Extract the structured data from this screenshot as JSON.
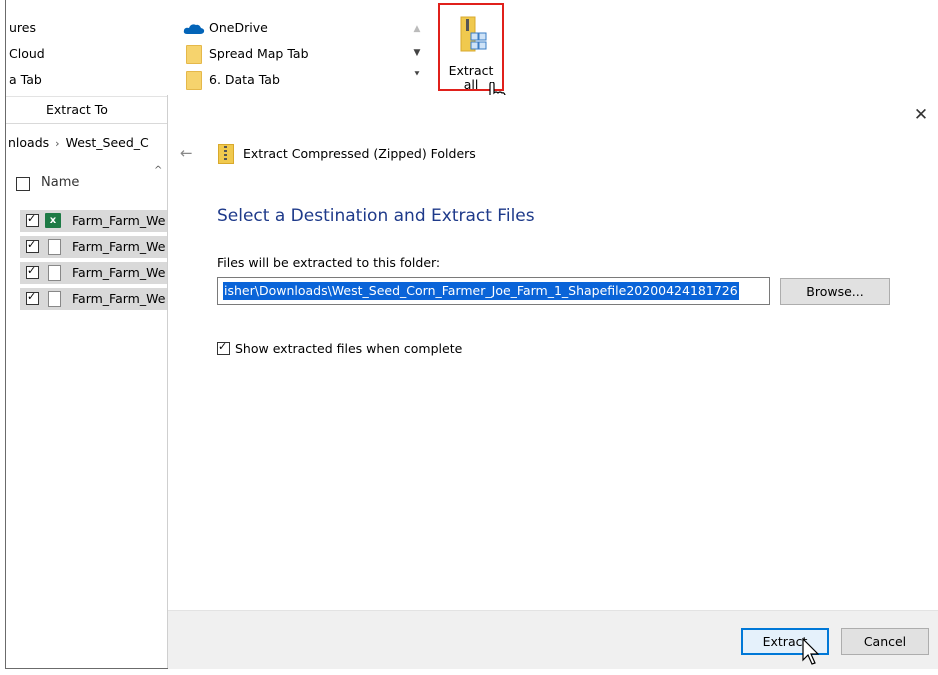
{
  "ribbon": {
    "quick_access_left": [
      "ures",
      "Cloud",
      "a Tab"
    ],
    "quick_access_mid": [
      {
        "label": "OneDrive",
        "icon": "onedrive-cloud-icon"
      },
      {
        "label": "Spread Map Tab",
        "icon": "folder-icon"
      },
      {
        "label": "6.  Data Tab",
        "icon": "folder-icon"
      }
    ],
    "extract_all_label": "Extract all",
    "extract_all_highlight_color": "#e0201b",
    "group_label": "Extract To"
  },
  "explorer": {
    "breadcrumb": [
      "nloads",
      "West_Seed_C"
    ],
    "column_header": "Name",
    "files": [
      {
        "name": "Farm_Farm_We",
        "icon": "excel-icon",
        "checked": true
      },
      {
        "name": "Farm_Farm_We",
        "icon": "document-icon",
        "checked": true
      },
      {
        "name": "Farm_Farm_We",
        "icon": "document-icon",
        "checked": true
      },
      {
        "name": "Farm_Farm_We",
        "icon": "document-icon",
        "checked": true
      }
    ]
  },
  "dialog": {
    "window_title": "Extract Compressed (Zipped) Folders",
    "heading": "Select a Destination and Extract Files",
    "destination_label": "Files will be extracted to this folder:",
    "destination_path": "isher\\Downloads\\West_Seed_Corn_Farmer_Joe_Farm_1_Shapefile20200424181726",
    "browse_label": "Browse...",
    "show_files_label": "Show extracted files when complete",
    "show_files_checked": true,
    "extract_label": "Extract",
    "cancel_label": "Cancel",
    "heading_color": "#1e3a8a",
    "accent_color": "#0078d7"
  }
}
